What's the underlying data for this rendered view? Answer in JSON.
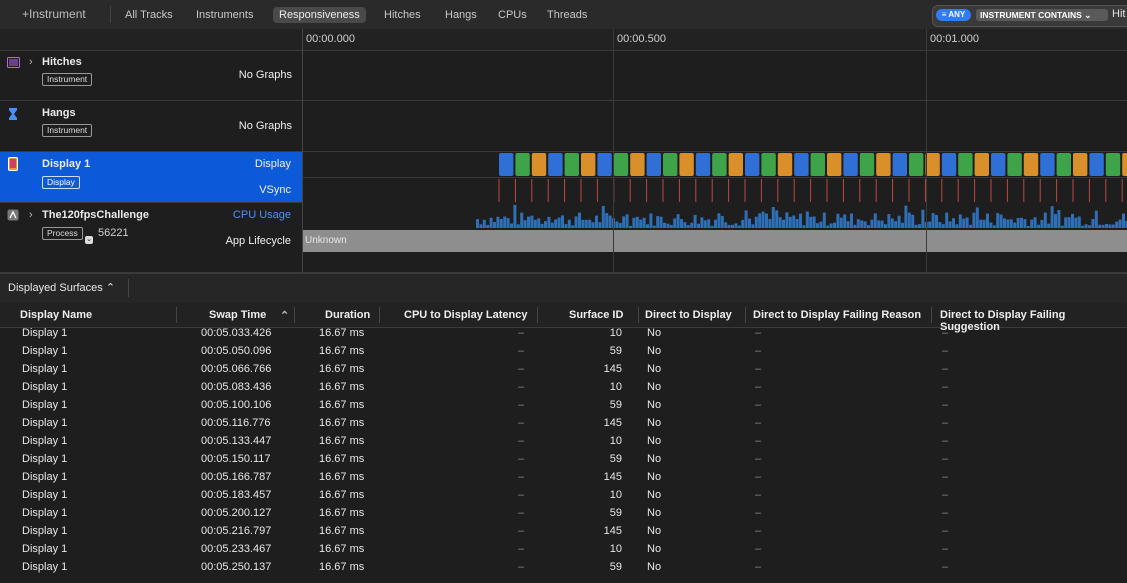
{
  "toolbar": {
    "add_instrument": "+Instrument",
    "tabs": [
      "All Tracks",
      "Instruments",
      "Responsiveness",
      "Hitches",
      "Hangs",
      "CPUs",
      "Threads"
    ],
    "active_tab": "Responsiveness",
    "filter": {
      "any_label": "ANY",
      "contains_label": "INSTRUMENT CONTAINS",
      "text": "Hit"
    }
  },
  "timeline": {
    "ticks": [
      "00:00.000",
      "00:00.500",
      "00:01.000"
    ]
  },
  "tracks": {
    "hitches": {
      "name": "Hitches",
      "badge": "Instrument",
      "label": "No Graphs"
    },
    "hangs": {
      "name": "Hangs",
      "badge": "Instrument",
      "label": "No Graphs"
    },
    "display": {
      "name": "Display 1",
      "badge": "Display",
      "lane1": "Display",
      "lane2": "VSync"
    },
    "process": {
      "name": "The120fpsChallenge",
      "badge": "Process",
      "pid": "56221",
      "cpu_label": "CPU Usage",
      "lifecycle_label": "App Lifecycle",
      "lifecycle_value": "Unknown"
    }
  },
  "detail": {
    "selector": "Displayed Surfaces",
    "columns": [
      "Display Name",
      "Swap Time",
      "Duration",
      "CPU to Display Latency",
      "Surface ID",
      "Direct to Display",
      "Direct to Display Failing Reason",
      "Direct to Display Failing Suggestion"
    ],
    "rows": [
      [
        "Display 1",
        "00:05.033.426",
        "16.67 ms",
        "–",
        "10",
        "No",
        "–",
        "–"
      ],
      [
        "Display 1",
        "00:05.050.096",
        "16.67 ms",
        "–",
        "59",
        "No",
        "–",
        "–"
      ],
      [
        "Display 1",
        "00:05.066.766",
        "16.67 ms",
        "–",
        "145",
        "No",
        "–",
        "–"
      ],
      [
        "Display 1",
        "00:05.083.436",
        "16.67 ms",
        "–",
        "10",
        "No",
        "–",
        "–"
      ],
      [
        "Display 1",
        "00:05.100.106",
        "16.67 ms",
        "–",
        "59",
        "No",
        "–",
        "–"
      ],
      [
        "Display 1",
        "00:05.116.776",
        "16.67 ms",
        "–",
        "145",
        "No",
        "–",
        "–"
      ],
      [
        "Display 1",
        "00:05.133.447",
        "16.67 ms",
        "–",
        "10",
        "No",
        "–",
        "–"
      ],
      [
        "Display 1",
        "00:05.150.117",
        "16.67 ms",
        "–",
        "59",
        "No",
        "–",
        "–"
      ],
      [
        "Display 1",
        "00:05.166.787",
        "16.67 ms",
        "–",
        "145",
        "No",
        "–",
        "–"
      ],
      [
        "Display 1",
        "00:05.183.457",
        "16.67 ms",
        "–",
        "10",
        "No",
        "–",
        "–"
      ],
      [
        "Display 1",
        "00:05.200.127",
        "16.67 ms",
        "–",
        "59",
        "No",
        "–",
        "–"
      ],
      [
        "Display 1",
        "00:05.216.797",
        "16.67 ms",
        "–",
        "145",
        "No",
        "–",
        "–"
      ],
      [
        "Display 1",
        "00:05.233.467",
        "16.67 ms",
        "–",
        "10",
        "No",
        "–",
        "–"
      ],
      [
        "Display 1",
        "00:05.250.137",
        "16.67 ms",
        "–",
        "59",
        "No",
        "–",
        "–"
      ]
    ]
  },
  "colors": {
    "selection": "#0d5ad8",
    "surface_blue": "#2f6fd6",
    "surface_green": "#3fa34a",
    "surface_orange": "#d98f2a",
    "vsync": "#c0463f",
    "cpu": "#2f6fb8"
  }
}
